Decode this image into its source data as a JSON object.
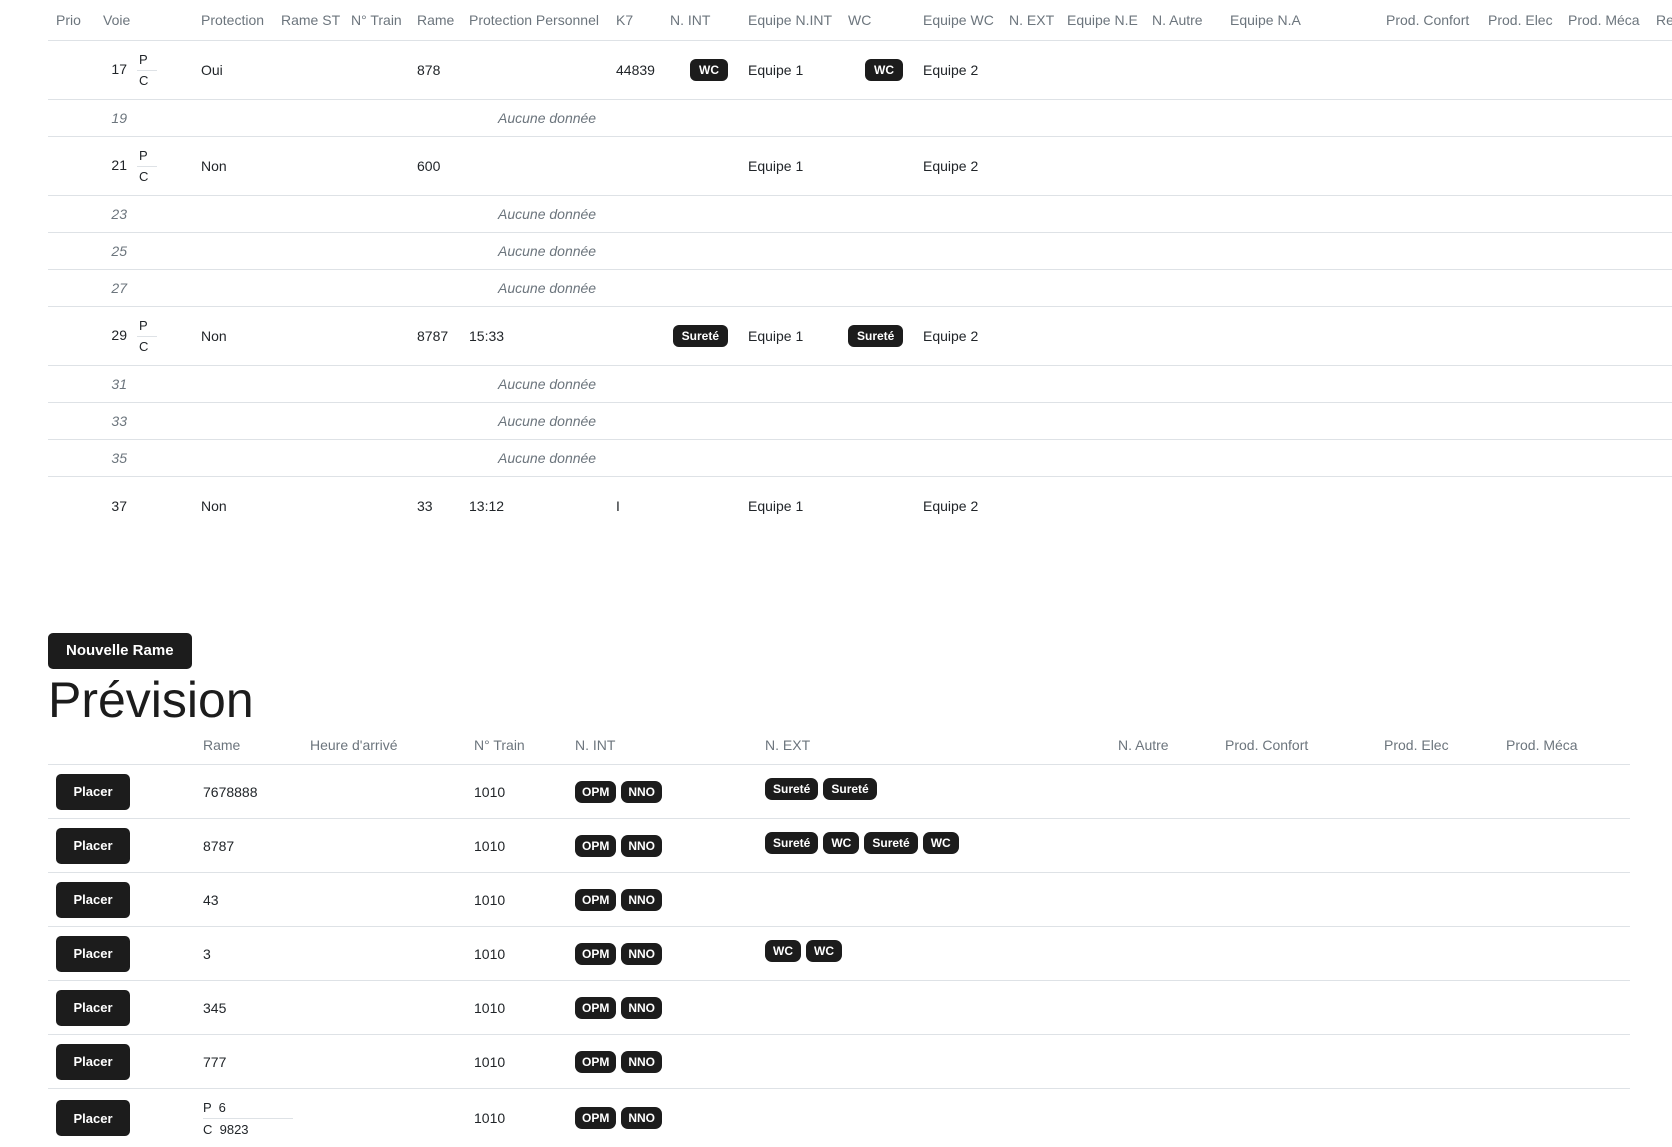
{
  "voies_table": {
    "headers": [
      "Prio",
      "Voie",
      "Protection",
      "Rame ST",
      "N° Train",
      "Rame",
      "Protection Personnel",
      "K7",
      "N. INT",
      "Equipe N.INT",
      "WC",
      "Equipe WC",
      "N. EXT",
      "Equipe N.E",
      "N. Autre",
      "Equipe N.A",
      "Prod. Confort",
      "Prod. Elec",
      "Prod. Méca",
      "Rendu"
    ],
    "empty_label": "Aucune donnée",
    "rows": [
      {
        "prio": "",
        "voie": "17",
        "pc_top": "P",
        "pc_bottom": "C",
        "protection": "Oui",
        "rame": "878",
        "heure": "",
        "k7": "44839",
        "n_int": "WC",
        "equipe_n_int": "Equipe 1",
        "wc": "WC",
        "equipe_wc": "Equipe 2",
        "empty": false
      },
      {
        "voie": "19",
        "empty": true
      },
      {
        "prio": "",
        "voie": "21",
        "pc_top": "P",
        "pc_bottom": "C",
        "protection": "Non",
        "rame": "600",
        "heure": "",
        "k7": "",
        "n_int": "",
        "equipe_n_int": "Equipe 1",
        "wc": "",
        "equipe_wc": "Equipe 2",
        "empty": false
      },
      {
        "voie": "23",
        "empty": true
      },
      {
        "voie": "25",
        "empty": true
      },
      {
        "voie": "27",
        "empty": true
      },
      {
        "prio": "",
        "voie": "29",
        "pc_top": "P",
        "pc_bottom": "C",
        "protection": "Non",
        "rame": "8787",
        "heure": "15:33",
        "k7": "",
        "n_int": "Sureté",
        "equipe_n_int": "Equipe 1",
        "wc": "Sureté",
        "equipe_wc": "Equipe 2",
        "empty": false
      },
      {
        "voie": "31",
        "empty": true
      },
      {
        "voie": "33",
        "empty": true
      },
      {
        "voie": "35",
        "empty": true
      },
      {
        "prio": "",
        "voie": "37",
        "pc_top": "",
        "pc_bottom": "",
        "protection": "Non",
        "rame": "33",
        "heure": "13:12",
        "k7": "I",
        "n_int": "",
        "equipe_n_int": "Equipe 1",
        "wc": "",
        "equipe_wc": "Equipe 2",
        "empty": false
      }
    ]
  },
  "new_rame_button": "Nouvelle Rame",
  "prevision": {
    "title": "Prévision",
    "headers": [
      "",
      "Rame",
      "Heure d'arrivé",
      "N° Train",
      "N. INT",
      "N. EXT",
      "N. Autre",
      "Prod. Confort",
      "Prod. Elec",
      "Prod. Méca"
    ],
    "placer_label": "Placer",
    "rows": [
      {
        "rame": "7678888",
        "train": "1010",
        "n_int": [
          "OPM",
          "NNO"
        ],
        "n_ext": [
          "Sureté",
          "Sureté"
        ]
      },
      {
        "rame": "8787",
        "train": "1010",
        "n_int": [
          "OPM",
          "NNO"
        ],
        "n_ext": [
          "Sureté",
          "WC",
          "Sureté",
          "WC"
        ]
      },
      {
        "rame": "43",
        "train": "1010",
        "n_int": [
          "OPM",
          "NNO"
        ],
        "n_ext": []
      },
      {
        "rame": "3",
        "train": "1010",
        "n_int": [
          "OPM",
          "NNO"
        ],
        "n_ext": [
          "WC",
          "WC"
        ]
      },
      {
        "rame": "345",
        "train": "1010",
        "n_int": [
          "OPM",
          "NNO"
        ],
        "n_ext": []
      },
      {
        "rame": "777",
        "train": "1010",
        "n_int": [
          "OPM",
          "NNO"
        ],
        "n_ext": []
      },
      {
        "rame_top": "P  6",
        "rame_bottom": "C  9823",
        "train": "1010",
        "n_int": [
          "OPM",
          "NNO"
        ],
        "n_ext": []
      }
    ]
  }
}
